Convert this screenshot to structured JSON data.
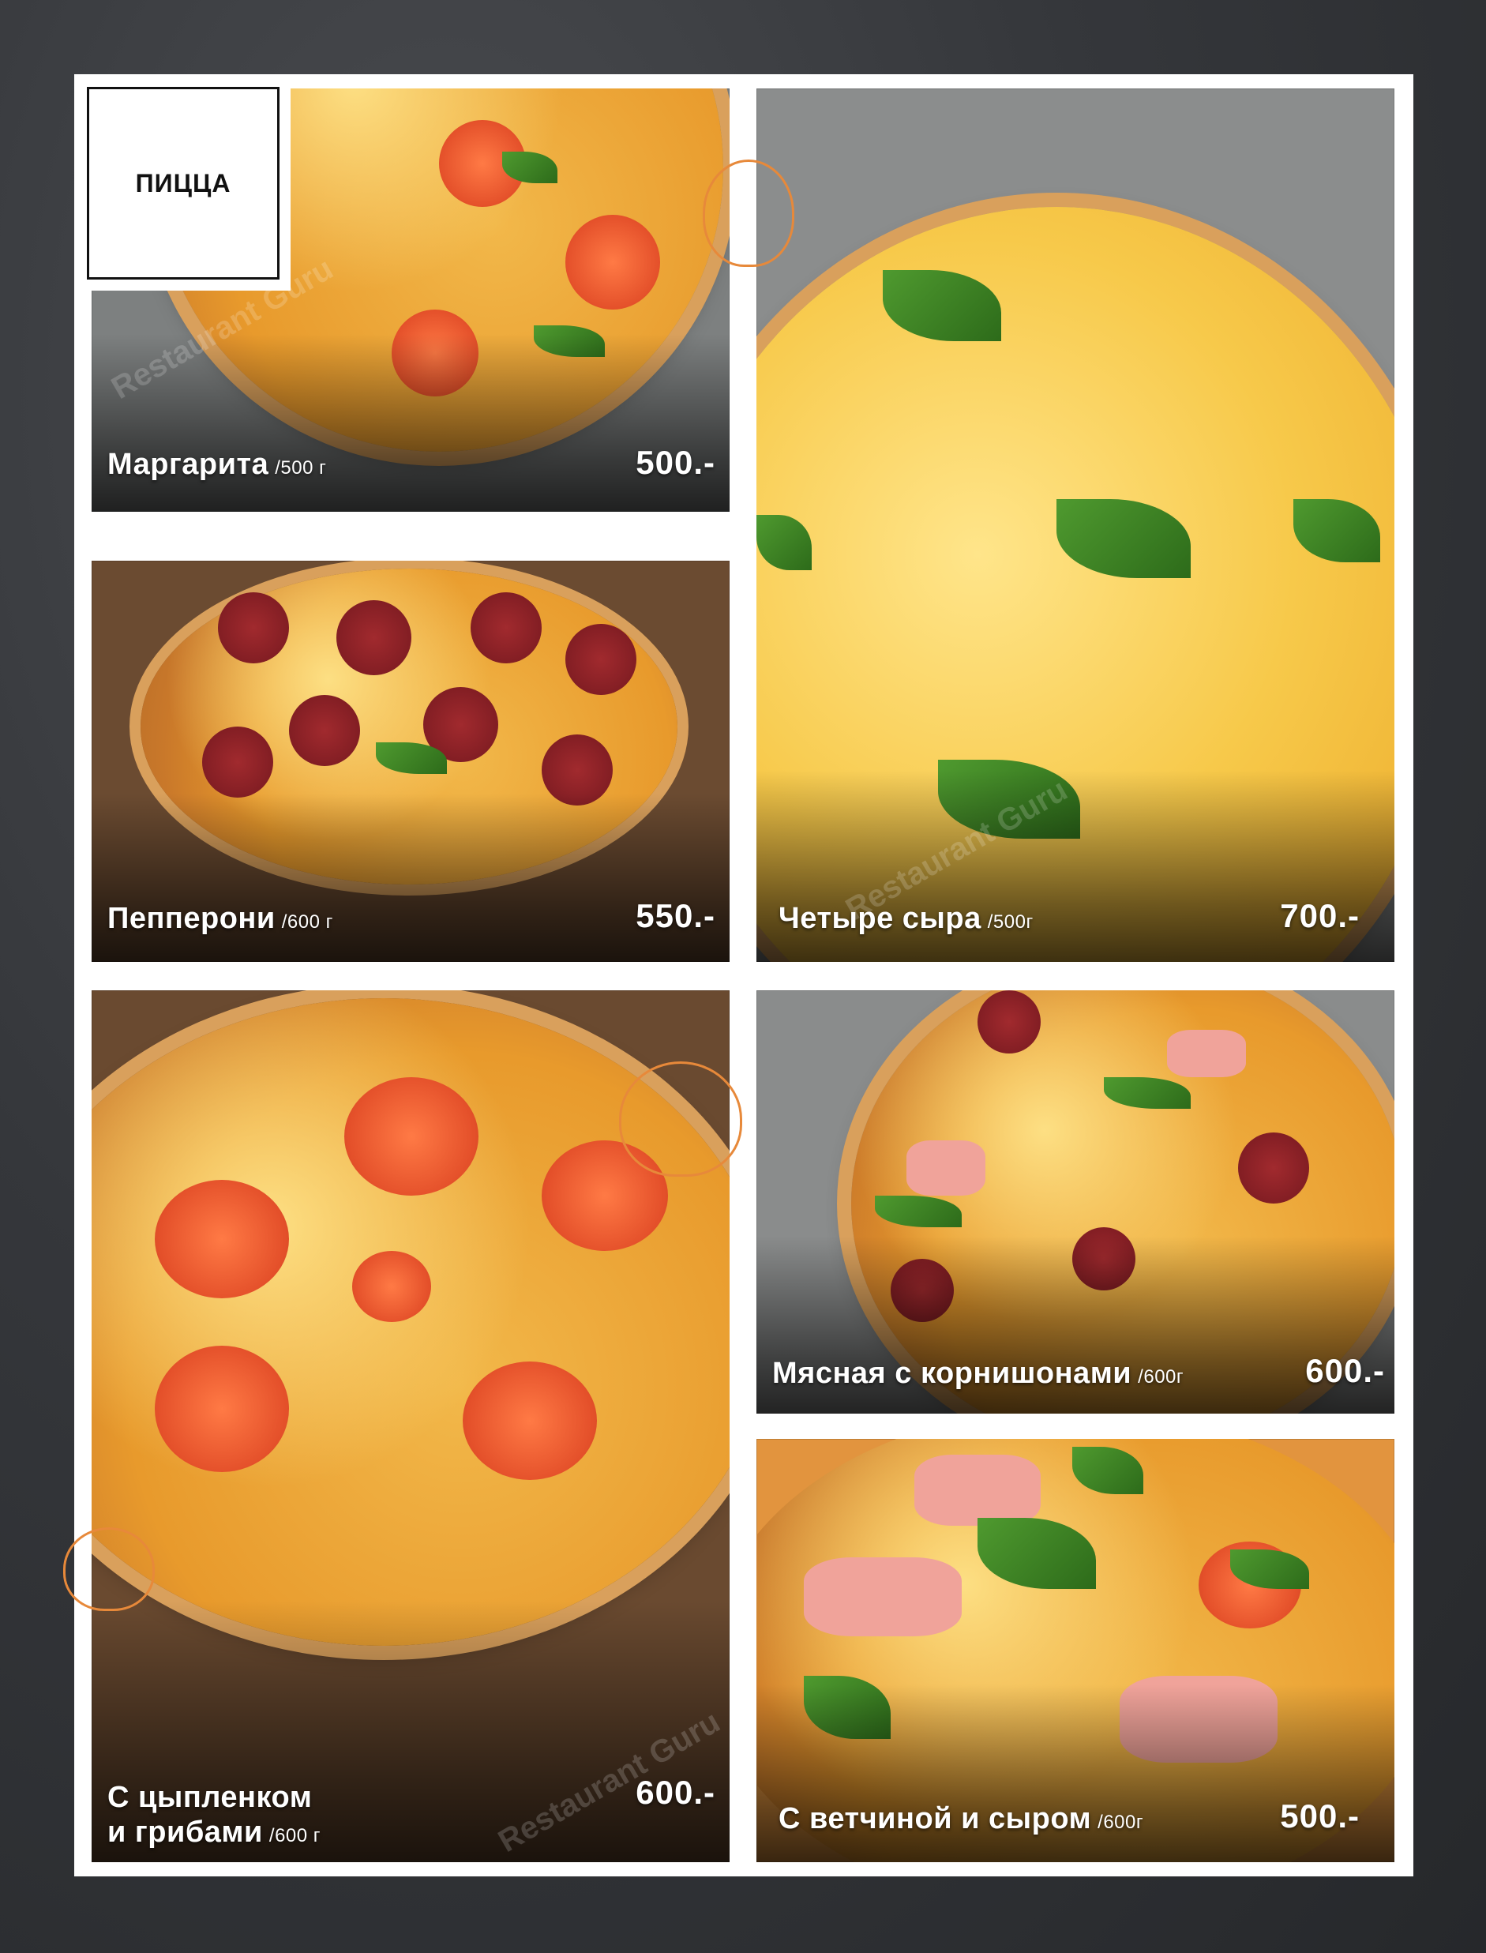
{
  "section": {
    "heading": "ПИЦЦА"
  },
  "items": [
    {
      "name": "Маргарита",
      "weight": "/500 г",
      "price": "500.-"
    },
    {
      "name": "Пепперони",
      "weight": "/600 г",
      "price": "550.-"
    },
    {
      "name": "Четыре сыра",
      "weight": "/500г",
      "price": "700.-"
    },
    {
      "name_line1": "С цыпленком",
      "name_line2": "и грибами",
      "weight": "/600 г",
      "price": "600.-"
    },
    {
      "name": "Мясная с корнишонами",
      "weight": "/600г",
      "price": "600.-"
    },
    {
      "name": "С ветчиной и сыром",
      "weight": "/600г",
      "price": "500.-"
    }
  ],
  "watermark": "Restaurant Guru",
  "colors": {
    "accent": "#e7893a",
    "background": "#35373b"
  }
}
